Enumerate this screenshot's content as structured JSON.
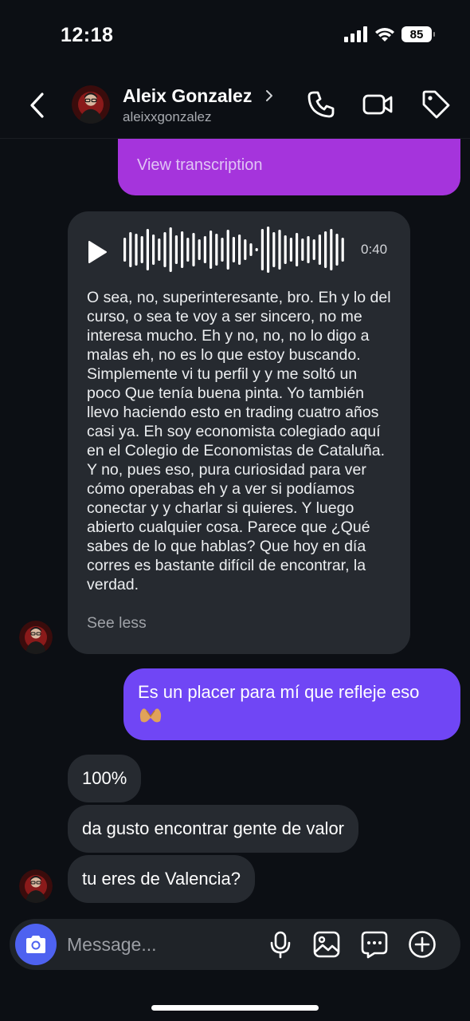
{
  "status_bar": {
    "time": "12:18",
    "battery": "85"
  },
  "header": {
    "name": "Aleix Gonzalez",
    "handle": "aleixxgonzalez"
  },
  "messages": {
    "outgoing_top": {
      "link": "View transcription"
    },
    "voice": {
      "duration": "0:40",
      "transcript": "O sea, no, superinteresante, bro. Eh y lo del curso, o sea te voy a ser sincero, no me interesa mucho. Eh y no, no, no lo digo a malas eh, no es lo que estoy buscando. Simplemente vi tu perfil y y me soltó un poco Que tenía buena pinta. Yo también llevo haciendo esto en trading cuatro años casi ya. Eh soy economista colegiado aquí en el Colegio de Economistas de Cataluña. Y no, pues eso, pura curiosidad para ver cómo operabas eh y a ver si podíamos conectar y y charlar si quieres. Y luego abierto cualquier cosa. Parece que ¿Qué sabes de lo que hablas? Que hoy en día corres es bastante difícil de encontrar, la verdad.",
      "see_less": "See less"
    },
    "outgoing": {
      "text": "Es un placer para mí que refleje eso"
    },
    "incoming": [
      "100%",
      "da gusto encontrar gente de valor",
      "tu eres de Valencia?"
    ]
  },
  "composer": {
    "placeholder": "Message..."
  },
  "colors": {
    "background": "#0c0f14",
    "outgoing_purple": "#7046f5",
    "outgoing_magenta": "#a534dc",
    "incoming_gray": "#262a30",
    "camera_blue": "#4e62f0"
  },
  "icons": [
    "back-icon",
    "chevron-right-icon",
    "phone-icon",
    "video-icon",
    "tag-icon",
    "play-icon",
    "heart-hands-emoji",
    "camera-icon",
    "mic-icon",
    "gallery-icon",
    "sticker-icon",
    "add-icon"
  ]
}
